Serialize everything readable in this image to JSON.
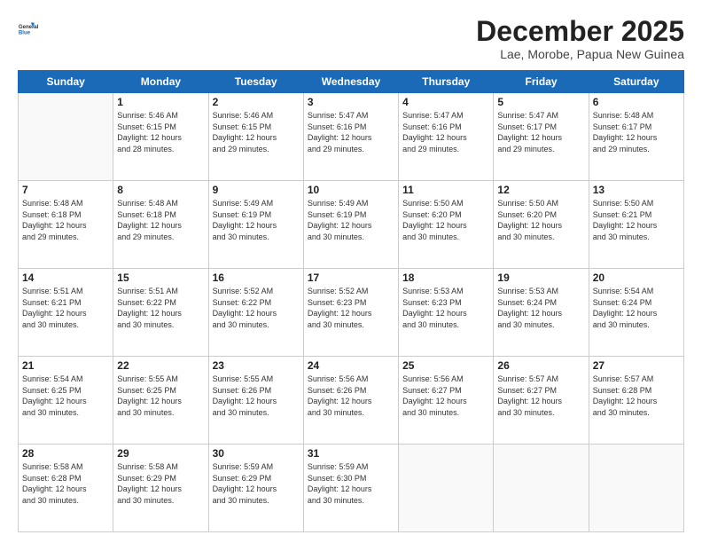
{
  "header": {
    "logo_line1": "General",
    "logo_line2": "Blue",
    "month": "December 2025",
    "location": "Lae, Morobe, Papua New Guinea"
  },
  "weekdays": [
    "Sunday",
    "Monday",
    "Tuesday",
    "Wednesday",
    "Thursday",
    "Friday",
    "Saturday"
  ],
  "weeks": [
    [
      {
        "day": "",
        "info": ""
      },
      {
        "day": "1",
        "info": "Sunrise: 5:46 AM\nSunset: 6:15 PM\nDaylight: 12 hours\nand 28 minutes."
      },
      {
        "day": "2",
        "info": "Sunrise: 5:46 AM\nSunset: 6:15 PM\nDaylight: 12 hours\nand 29 minutes."
      },
      {
        "day": "3",
        "info": "Sunrise: 5:47 AM\nSunset: 6:16 PM\nDaylight: 12 hours\nand 29 minutes."
      },
      {
        "day": "4",
        "info": "Sunrise: 5:47 AM\nSunset: 6:16 PM\nDaylight: 12 hours\nand 29 minutes."
      },
      {
        "day": "5",
        "info": "Sunrise: 5:47 AM\nSunset: 6:17 PM\nDaylight: 12 hours\nand 29 minutes."
      },
      {
        "day": "6",
        "info": "Sunrise: 5:48 AM\nSunset: 6:17 PM\nDaylight: 12 hours\nand 29 minutes."
      }
    ],
    [
      {
        "day": "7",
        "info": "Sunrise: 5:48 AM\nSunset: 6:18 PM\nDaylight: 12 hours\nand 29 minutes."
      },
      {
        "day": "8",
        "info": "Sunrise: 5:48 AM\nSunset: 6:18 PM\nDaylight: 12 hours\nand 29 minutes."
      },
      {
        "day": "9",
        "info": "Sunrise: 5:49 AM\nSunset: 6:19 PM\nDaylight: 12 hours\nand 30 minutes."
      },
      {
        "day": "10",
        "info": "Sunrise: 5:49 AM\nSunset: 6:19 PM\nDaylight: 12 hours\nand 30 minutes."
      },
      {
        "day": "11",
        "info": "Sunrise: 5:50 AM\nSunset: 6:20 PM\nDaylight: 12 hours\nand 30 minutes."
      },
      {
        "day": "12",
        "info": "Sunrise: 5:50 AM\nSunset: 6:20 PM\nDaylight: 12 hours\nand 30 minutes."
      },
      {
        "day": "13",
        "info": "Sunrise: 5:50 AM\nSunset: 6:21 PM\nDaylight: 12 hours\nand 30 minutes."
      }
    ],
    [
      {
        "day": "14",
        "info": "Sunrise: 5:51 AM\nSunset: 6:21 PM\nDaylight: 12 hours\nand 30 minutes."
      },
      {
        "day": "15",
        "info": "Sunrise: 5:51 AM\nSunset: 6:22 PM\nDaylight: 12 hours\nand 30 minutes."
      },
      {
        "day": "16",
        "info": "Sunrise: 5:52 AM\nSunset: 6:22 PM\nDaylight: 12 hours\nand 30 minutes."
      },
      {
        "day": "17",
        "info": "Sunrise: 5:52 AM\nSunset: 6:23 PM\nDaylight: 12 hours\nand 30 minutes."
      },
      {
        "day": "18",
        "info": "Sunrise: 5:53 AM\nSunset: 6:23 PM\nDaylight: 12 hours\nand 30 minutes."
      },
      {
        "day": "19",
        "info": "Sunrise: 5:53 AM\nSunset: 6:24 PM\nDaylight: 12 hours\nand 30 minutes."
      },
      {
        "day": "20",
        "info": "Sunrise: 5:54 AM\nSunset: 6:24 PM\nDaylight: 12 hours\nand 30 minutes."
      }
    ],
    [
      {
        "day": "21",
        "info": "Sunrise: 5:54 AM\nSunset: 6:25 PM\nDaylight: 12 hours\nand 30 minutes."
      },
      {
        "day": "22",
        "info": "Sunrise: 5:55 AM\nSunset: 6:25 PM\nDaylight: 12 hours\nand 30 minutes."
      },
      {
        "day": "23",
        "info": "Sunrise: 5:55 AM\nSunset: 6:26 PM\nDaylight: 12 hours\nand 30 minutes."
      },
      {
        "day": "24",
        "info": "Sunrise: 5:56 AM\nSunset: 6:26 PM\nDaylight: 12 hours\nand 30 minutes."
      },
      {
        "day": "25",
        "info": "Sunrise: 5:56 AM\nSunset: 6:27 PM\nDaylight: 12 hours\nand 30 minutes."
      },
      {
        "day": "26",
        "info": "Sunrise: 5:57 AM\nSunset: 6:27 PM\nDaylight: 12 hours\nand 30 minutes."
      },
      {
        "day": "27",
        "info": "Sunrise: 5:57 AM\nSunset: 6:28 PM\nDaylight: 12 hours\nand 30 minutes."
      }
    ],
    [
      {
        "day": "28",
        "info": "Sunrise: 5:58 AM\nSunset: 6:28 PM\nDaylight: 12 hours\nand 30 minutes."
      },
      {
        "day": "29",
        "info": "Sunrise: 5:58 AM\nSunset: 6:29 PM\nDaylight: 12 hours\nand 30 minutes."
      },
      {
        "day": "30",
        "info": "Sunrise: 5:59 AM\nSunset: 6:29 PM\nDaylight: 12 hours\nand 30 minutes."
      },
      {
        "day": "31",
        "info": "Sunrise: 5:59 AM\nSunset: 6:30 PM\nDaylight: 12 hours\nand 30 minutes."
      },
      {
        "day": "",
        "info": ""
      },
      {
        "day": "",
        "info": ""
      },
      {
        "day": "",
        "info": ""
      }
    ]
  ]
}
